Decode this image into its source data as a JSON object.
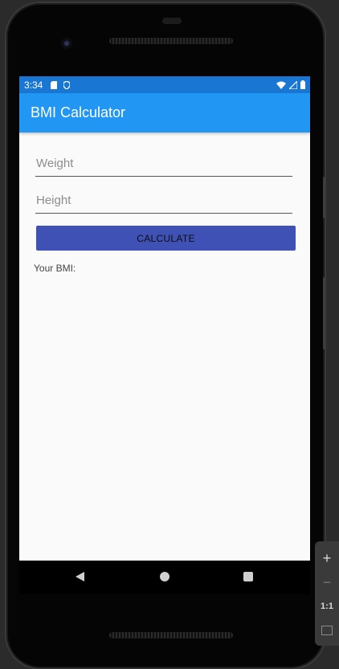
{
  "status_bar": {
    "time": "3:34",
    "icons_left": [
      "sd-card-icon",
      "shield-icon"
    ],
    "icons_right": [
      "wifi-icon",
      "signal-icon",
      "battery-icon"
    ]
  },
  "app_bar": {
    "title": "BMI Calculator"
  },
  "form": {
    "weight_placeholder": "Weight",
    "weight_value": "",
    "height_placeholder": "Height",
    "height_value": "",
    "calculate_label": "CALCULATE"
  },
  "result": {
    "label": "Your BMI:"
  },
  "emulator_toolbar": {
    "zoom_in": "+",
    "zoom_out": "−",
    "actual_size": "1:1"
  },
  "colors": {
    "status_bar": "#1976d2",
    "app_bar": "#2196f3",
    "button": "#3f51b5",
    "screen_bg": "#fafafa"
  }
}
